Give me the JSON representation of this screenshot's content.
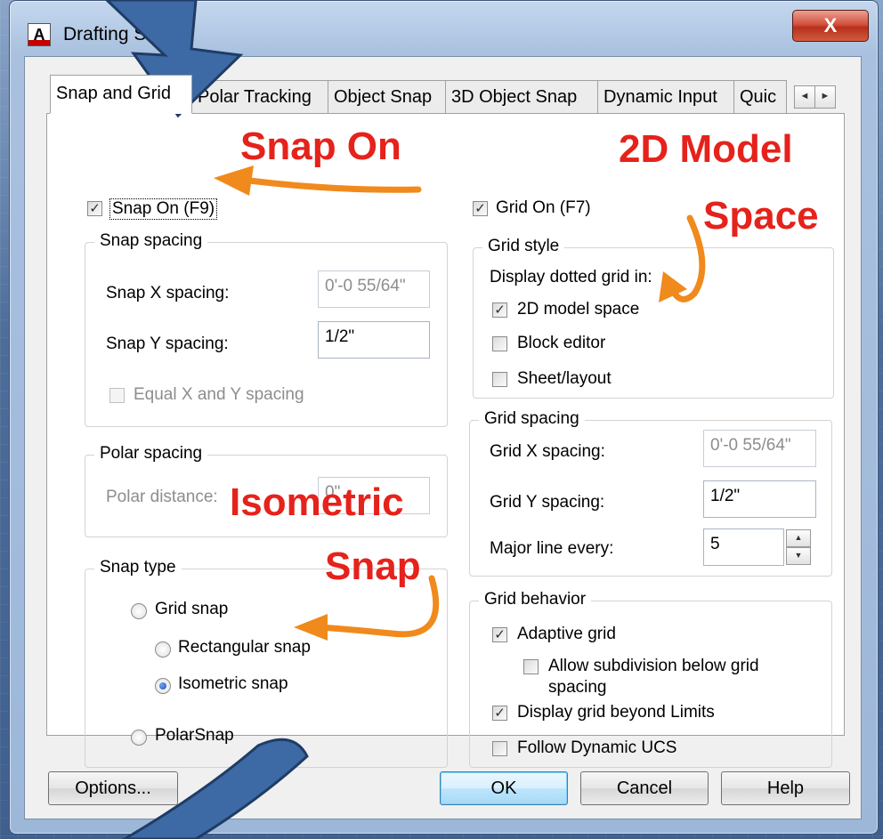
{
  "window": {
    "title": "Drafting Settings",
    "title_visible": "Drafting Se",
    "app_icon_letter": "A",
    "close_label": "X"
  },
  "tabs": [
    {
      "label": "Snap and Grid",
      "active": true
    },
    {
      "label": "Polar Tracking"
    },
    {
      "label": "Object Snap"
    },
    {
      "label": "3D Object Snap"
    },
    {
      "label": "Dynamic Input"
    },
    {
      "label": "Quic"
    }
  ],
  "tab_scroll": {
    "left": "◄",
    "right": "►"
  },
  "snap": {
    "snap_on_label": "Snap On (F9)",
    "snap_on_checked": true,
    "spacing_title": "Snap spacing",
    "x_label": "Snap X spacing:",
    "x_value": "0'-0 55/64\"",
    "y_label": "Snap Y spacing:",
    "y_value": "1/2\"",
    "equal_label": "Equal X and Y spacing"
  },
  "polar": {
    "title": "Polar spacing",
    "distance_label": "Polar distance:",
    "distance_value": "0\""
  },
  "snap_type": {
    "title": "Snap type",
    "grid_snap": "Grid snap",
    "rectangular": "Rectangular snap",
    "isometric": "Isometric snap",
    "polarsnap": "PolarSnap",
    "selected": "isometric"
  },
  "grid": {
    "grid_on_label": "Grid On (F7)",
    "grid_on_checked": true,
    "style_title": "Grid style",
    "display_label": "Display dotted grid in:",
    "model_space": "2D model space",
    "block_editor": "Block editor",
    "sheet_layout": "Sheet/layout",
    "spacing_title": "Grid spacing",
    "x_label": "Grid X spacing:",
    "x_value": "0'-0 55/64\"",
    "y_label": "Grid Y spacing:",
    "y_value": "1/2\"",
    "major_label": "Major line every:",
    "major_value": "5",
    "behavior_title": "Grid behavior",
    "adaptive": "Adaptive grid",
    "subdivision_1": "Allow subdivision below grid",
    "subdivision_2": "spacing",
    "beyond_limits": "Display grid beyond Limits",
    "follow_ucs": "Follow Dynamic UCS"
  },
  "buttons": {
    "options": "Options...",
    "ok": "OK",
    "cancel": "Cancel",
    "help": "Help"
  },
  "annotations": {
    "snap_on": "Snap On",
    "model_line1": "2D Model",
    "model_line2": "Space",
    "iso_line1": "Isometric",
    "iso_line2": "Snap"
  },
  "colors": {
    "annotation_text": "#e5221b",
    "annotation_arrow": "#f08a1c",
    "big_arrow": "#3d6aa5"
  }
}
